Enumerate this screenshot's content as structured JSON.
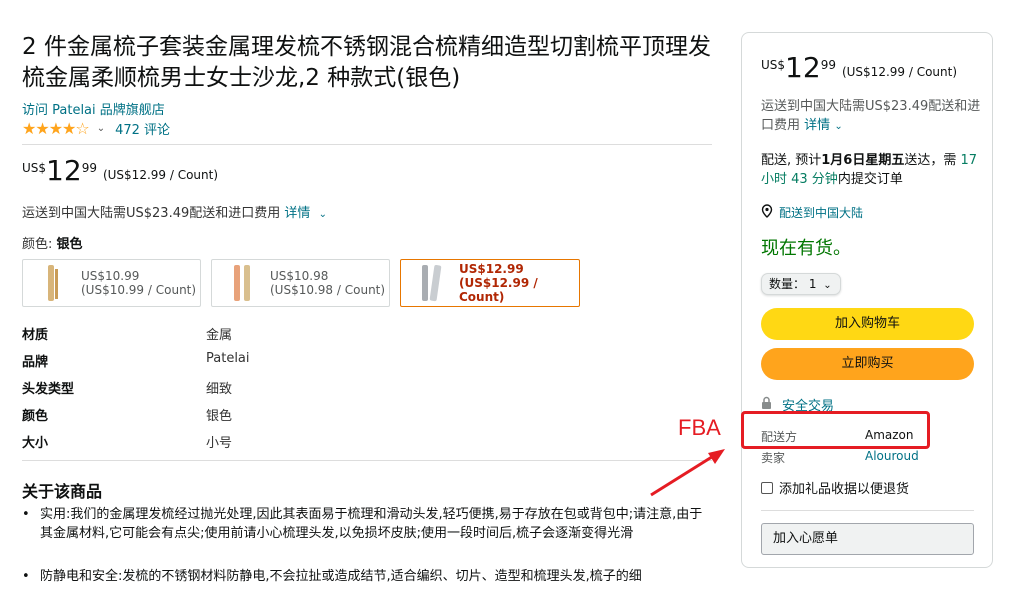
{
  "product": {
    "title": "2 件金属梳子套装金属理发梳不锈钢混合梳精细造型切割梳平顶理发梳金属柔顺梳男士女士沙龙,2 种款式(银色)",
    "store_link": "访问 Patelai 品牌旗舰店",
    "rating_stars": "★★★★☆",
    "rating_value": 4.5,
    "review_count": "472 评论"
  },
  "price": {
    "currency": "US$",
    "whole": "12",
    "fraction": "99",
    "unit_price": "(US$12.99 / Count)"
  },
  "shipping": {
    "text": "运送到中国大陆需US$23.49配送和进口费用",
    "details_link": "详情"
  },
  "color": {
    "label": "颜色:",
    "selected": "银色",
    "options": [
      {
        "price": "US$10.99",
        "unit": "(US$10.99 / Count)",
        "selected": false
      },
      {
        "price": "US$10.98",
        "unit": "(US$10.98 / Count)",
        "selected": false
      },
      {
        "price": "US$12.99",
        "unit": "(US$12.99 / Count)",
        "selected": true
      }
    ]
  },
  "specs": [
    {
      "key": "材质",
      "value": "金属"
    },
    {
      "key": "品牌",
      "value": "Patelai"
    },
    {
      "key": "头发类型",
      "value": "细致"
    },
    {
      "key": "颜色",
      "value": "银色"
    },
    {
      "key": "大小",
      "value": "小号"
    }
  ],
  "about": {
    "heading": "关于该商品",
    "bullets": [
      "实用:我们的金属理发梳经过抛光处理,因此其表面易于梳理和滑动头发,轻巧便携,易于存放在包或背包中;请注意,由于其金属材料,它可能会有点尖;使用前请小心梳理头发,以免损坏皮肤;使用一段时间后,梳子会逐渐变得光滑",
      "防静电和安全:发梳的不锈钢材料防静电,不会拉扯或造成结节,适合编织、切片、造型和梳理头发,梳子的细"
    ]
  },
  "buybox": {
    "currency": "US$",
    "whole": "12",
    "fraction": "99",
    "unit_price": "(US$12.99 / Count)",
    "shipping_text": "运送到中国大陆需US$23.49配送和进口费用",
    "details_link": "详情",
    "delivery_prefix": "配送, 预计",
    "delivery_date": "1月6日星期五",
    "delivery_mid": "送达，需",
    "delivery_countdown": "17 小时 43 分钟",
    "delivery_suffix": "内提交订单",
    "deliver_to": "配送到中国大陆",
    "stock": "现在有货。",
    "qty_label": "数量： 1",
    "add_to_cart": "加入购物车",
    "buy_now": "立即购买",
    "secure": "安全交易",
    "ships_from_label": "配送方",
    "ships_from_value": "Amazon",
    "sold_by_label": "卖家",
    "sold_by_value": "Alouroud",
    "gift_label": "添加礼品收据以便退货",
    "wishlist": "加入心愿单"
  },
  "annotation": {
    "label": "FBA",
    "color": "#E51C23"
  }
}
